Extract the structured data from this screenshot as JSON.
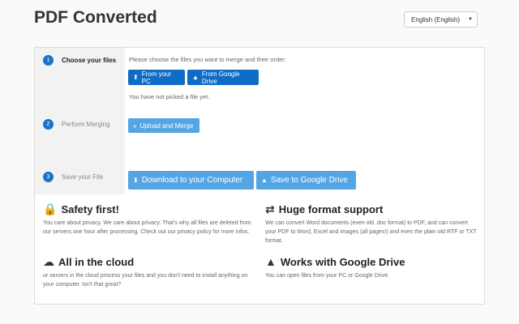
{
  "header": {
    "title": "PDF Converted"
  },
  "language": {
    "selected": "English (English)"
  },
  "steps": [
    {
      "num": "1",
      "label": "Choose your files"
    },
    {
      "num": "2",
      "label": "Perform Merging"
    },
    {
      "num": "3",
      "label": "Save your File"
    }
  ],
  "choose": {
    "instructions": "Please choose the files you want to merge and their order:",
    "from_pc": "From your PC",
    "from_drive": "From Google Drive",
    "status": "You have not picked a file yet."
  },
  "merge": {
    "button": "Upload and Merge"
  },
  "save": {
    "download": "Download to your Computer",
    "drive": "Save to Google Drive"
  },
  "features": [
    {
      "title": "Safety first!",
      "icon": "lock-icon",
      "text": "You care about privacy. We care about privacy. That's why all files are deleted from our servers one hour after processing. Check out our privacy policy for more infos."
    },
    {
      "title": "Huge format support",
      "icon": "shuffle-icon",
      "text": "We can convert Word documents (even old .doc format) to PDF, and can convert your PDF to Word, Excel and images (all pages!) and even the plain old RTF or TXT format."
    },
    {
      "title": "All in the cloud",
      "icon": "cloud-icon",
      "text": "ur servers in the cloud process your files and you don't need to install anything on your computer. Isn't that great?"
    },
    {
      "title": "Works with Google Drive",
      "icon": "google-drive-icon",
      "text": "You can open files from your PC or Google Drive."
    }
  ],
  "colors": {
    "primary": "#0f6cc4",
    "secondary": "#54a5e3"
  }
}
